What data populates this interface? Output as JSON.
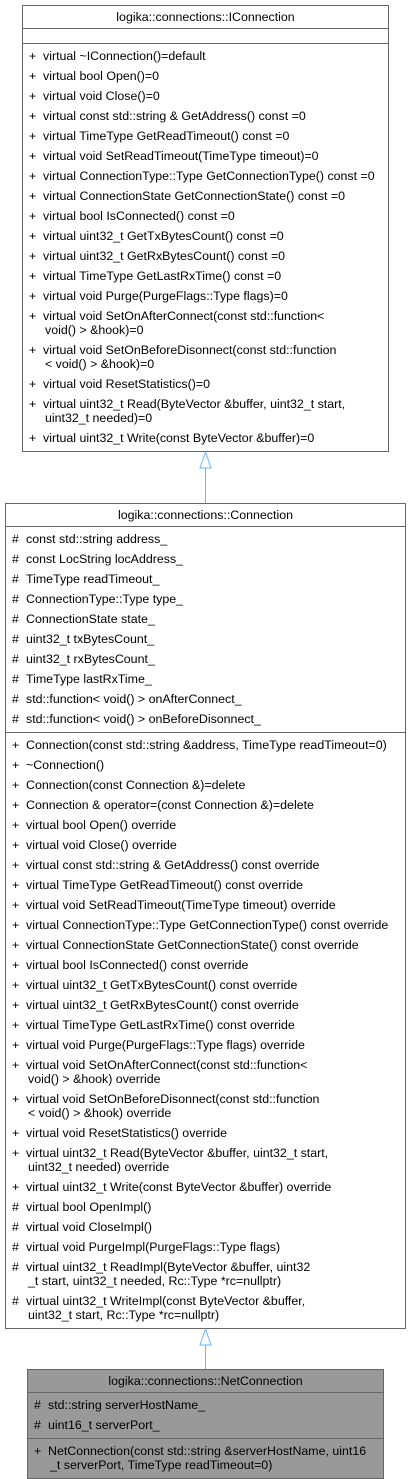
{
  "classes": {
    "iconnection": {
      "title": "logika::connections::IConnection",
      "attributes": [],
      "methods": [
        {
          "sym": "+",
          "lines": [
            "virtual ~IConnection()=default"
          ]
        },
        {
          "sym": "+",
          "lines": [
            "virtual bool Open()=0"
          ]
        },
        {
          "sym": "+",
          "lines": [
            "virtual void Close()=0"
          ]
        },
        {
          "sym": "+",
          "lines": [
            "virtual const std::string & GetAddress() const =0"
          ]
        },
        {
          "sym": "+",
          "lines": [
            "virtual TimeType GetReadTimeout() const =0"
          ]
        },
        {
          "sym": "+",
          "lines": [
            "virtual void SetReadTimeout(TimeType timeout)=0"
          ]
        },
        {
          "sym": "+",
          "lines": [
            "virtual ConnectionType::Type GetConnectionType() const =0"
          ]
        },
        {
          "sym": "+",
          "lines": [
            "virtual ConnectionState GetConnectionState() const =0"
          ]
        },
        {
          "sym": "+",
          "lines": [
            "virtual bool IsConnected() const =0"
          ]
        },
        {
          "sym": "+",
          "lines": [
            "virtual uint32_t GetTxBytesCount() const =0"
          ]
        },
        {
          "sym": "+",
          "lines": [
            "virtual uint32_t GetRxBytesCount() const =0"
          ]
        },
        {
          "sym": "+",
          "lines": [
            "virtual TimeType GetLastRxTime() const =0"
          ]
        },
        {
          "sym": "+",
          "lines": [
            "virtual void Purge(PurgeFlags::Type flags)=0"
          ]
        },
        {
          "sym": "+",
          "lines": [
            "virtual void SetOnAfterConnect(const std::function<",
            "void() > &hook)=0"
          ]
        },
        {
          "sym": "+",
          "lines": [
            "virtual void SetOnBeforeDisonnect(const std::function",
            "< void() > &hook)=0"
          ]
        },
        {
          "sym": "+",
          "lines": [
            "virtual void ResetStatistics()=0"
          ]
        },
        {
          "sym": "+",
          "lines": [
            "virtual uint32_t Read(ByteVector &buffer, uint32_t start,",
            "uint32_t needed)=0"
          ]
        },
        {
          "sym": "+",
          "lines": [
            "virtual uint32_t Write(const ByteVector &buffer)=0"
          ]
        }
      ]
    },
    "connection": {
      "title": "logika::connections::Connection",
      "attributes": [
        {
          "sym": "#",
          "lines": [
            "const std::string address_"
          ]
        },
        {
          "sym": "#",
          "lines": [
            "const LocString locAddress_"
          ]
        },
        {
          "sym": "#",
          "lines": [
            "TimeType readTimeout_"
          ]
        },
        {
          "sym": "#",
          "lines": [
            "ConnectionType::Type type_"
          ]
        },
        {
          "sym": "#",
          "lines": [
            "ConnectionState state_"
          ]
        },
        {
          "sym": "#",
          "lines": [
            "uint32_t txBytesCount_"
          ]
        },
        {
          "sym": "#",
          "lines": [
            "uint32_t rxBytesCount_"
          ]
        },
        {
          "sym": "#",
          "lines": [
            "TimeType lastRxTime_"
          ]
        },
        {
          "sym": "#",
          "lines": [
            "std::function< void() > onAfterConnect_"
          ]
        },
        {
          "sym": "#",
          "lines": [
            "std::function< void() > onBeforeDisonnect_"
          ]
        }
      ],
      "methods": [
        {
          "sym": "+",
          "lines": [
            "Connection(const std::string &address, TimeType readTimeout=0)"
          ]
        },
        {
          "sym": "+",
          "lines": [
            "~Connection()"
          ]
        },
        {
          "sym": "+",
          "lines": [
            "Connection(const Connection &)=delete"
          ]
        },
        {
          "sym": "+",
          "lines": [
            "Connection & operator=(const Connection &)=delete"
          ]
        },
        {
          "sym": "+",
          "lines": [
            "virtual bool Open() override"
          ]
        },
        {
          "sym": "+",
          "lines": [
            "virtual void Close() override"
          ]
        },
        {
          "sym": "+",
          "lines": [
            "virtual const std::string & GetAddress() const override"
          ]
        },
        {
          "sym": "+",
          "lines": [
            "virtual TimeType GetReadTimeout() const override"
          ]
        },
        {
          "sym": "+",
          "lines": [
            "virtual void SetReadTimeout(TimeType timeout) override"
          ]
        },
        {
          "sym": "+",
          "lines": [
            "virtual ConnectionType::Type GetConnectionType() const override"
          ]
        },
        {
          "sym": "+",
          "lines": [
            "virtual ConnectionState GetConnectionState() const override"
          ]
        },
        {
          "sym": "+",
          "lines": [
            "virtual bool IsConnected() const override"
          ]
        },
        {
          "sym": "+",
          "lines": [
            "virtual uint32_t GetTxBytesCount() const override"
          ]
        },
        {
          "sym": "+",
          "lines": [
            "virtual uint32_t GetRxBytesCount() const override"
          ]
        },
        {
          "sym": "+",
          "lines": [
            "virtual TimeType GetLastRxTime() const override"
          ]
        },
        {
          "sym": "+",
          "lines": [
            "virtual void Purge(PurgeFlags::Type flags) override"
          ]
        },
        {
          "sym": "+",
          "lines": [
            "virtual void SetOnAfterConnect(const std::function<",
            "void() > &hook) override"
          ]
        },
        {
          "sym": "+",
          "lines": [
            "virtual void SetOnBeforeDisonnect(const std::function",
            "< void() > &hook) override"
          ]
        },
        {
          "sym": "+",
          "lines": [
            "virtual void ResetStatistics() override"
          ]
        },
        {
          "sym": "+",
          "lines": [
            "virtual uint32_t Read(ByteVector &buffer, uint32_t start,",
            "uint32_t needed) override"
          ]
        },
        {
          "sym": "+",
          "lines": [
            "virtual uint32_t Write(const ByteVector &buffer) override"
          ]
        },
        {
          "sym": "#",
          "lines": [
            "virtual bool OpenImpl()"
          ]
        },
        {
          "sym": "#",
          "lines": [
            "virtual void CloseImpl()"
          ]
        },
        {
          "sym": "#",
          "lines": [
            "virtual void PurgeImpl(PurgeFlags::Type flags)"
          ]
        },
        {
          "sym": "#",
          "lines": [
            "virtual uint32_t ReadImpl(ByteVector &buffer, uint32",
            "_t start, uint32_t needed, Rc::Type *rc=nullptr)"
          ]
        },
        {
          "sym": "#",
          "lines": [
            "virtual uint32_t WriteImpl(const ByteVector &buffer,",
            "uint32_t start, Rc::Type *rc=nullptr)"
          ]
        }
      ]
    },
    "netconnection": {
      "title": "logika::connections::NetConnection",
      "attributes": [
        {
          "sym": "#",
          "lines": [
            "std::string serverHostName_"
          ]
        },
        {
          "sym": "#",
          "lines": [
            "uint16_t serverPort_"
          ]
        }
      ],
      "methods": [
        {
          "sym": "+",
          "lines": [
            "NetConnection(const std::string &serverHostName, uint16",
            "_t serverPort, TimeType readTimeout=0)"
          ]
        }
      ]
    }
  },
  "colors": {
    "border": "#666666",
    "highlight": "#999999",
    "arrow": "#63b8ff"
  }
}
